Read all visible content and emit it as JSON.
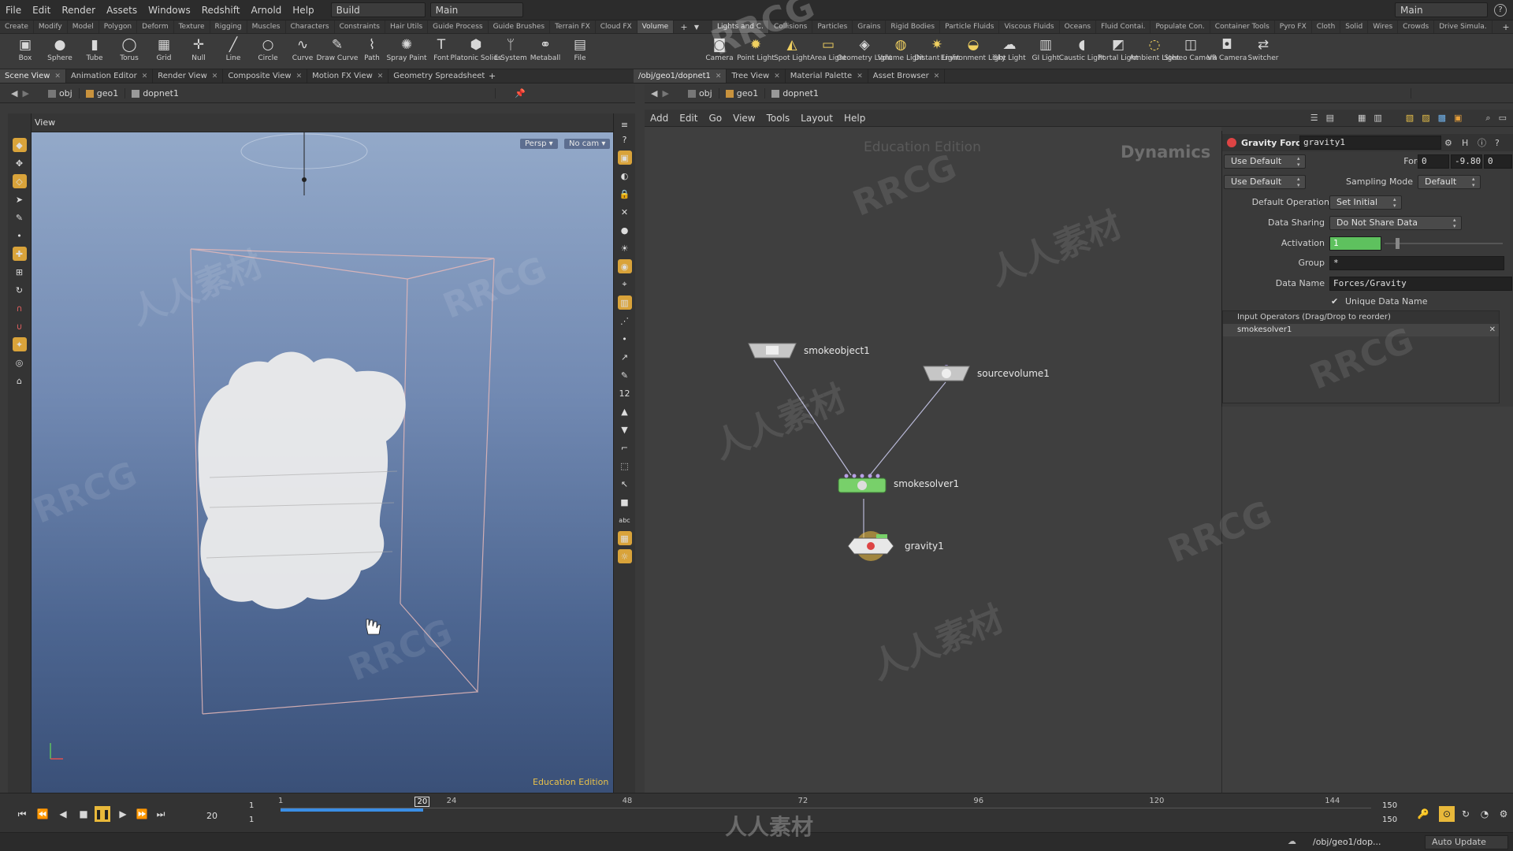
{
  "menubar": {
    "items": [
      "File",
      "Edit",
      "Render",
      "Assets",
      "Windows",
      "Redshift",
      "Arnold",
      "Help"
    ],
    "desktop_label": "Build",
    "main_label": "Main",
    "right_label": "Main"
  },
  "shelf_tabs_left": [
    "Create",
    "Modify",
    "Model",
    "Polygon",
    "Deform",
    "Texture",
    "Rigging",
    "Muscles",
    "Characters",
    "Constraints",
    "Hair Utils",
    "Guide Process",
    "Guide Brushes",
    "Terrain FX",
    "Cloud FX",
    "Volume"
  ],
  "shelf_tabs_right": [
    "Lights and C.",
    "Collisions",
    "Particles",
    "Grains",
    "Rigid Bodies",
    "Particle Fluids",
    "Viscous Fluids",
    "Oceans",
    "Fluid Contai.",
    "Populate Con.",
    "Container Tools",
    "Pyro FX",
    "Cloth",
    "Solid",
    "Wires",
    "Crowds",
    "Drive Simula."
  ],
  "tools_left": [
    {
      "label": "Box",
      "icon": "box-icon"
    },
    {
      "label": "Sphere",
      "icon": "sphere-icon"
    },
    {
      "label": "Tube",
      "icon": "tube-icon"
    },
    {
      "label": "Torus",
      "icon": "torus-icon"
    },
    {
      "label": "Grid",
      "icon": "grid-icon"
    },
    {
      "label": "Null",
      "icon": "null-icon"
    },
    {
      "label": "Line",
      "icon": "line-icon"
    },
    {
      "label": "Circle",
      "icon": "circle-icon"
    },
    {
      "label": "Curve",
      "icon": "curve-icon"
    },
    {
      "label": "Draw Curve",
      "icon": "draw-curve-icon"
    },
    {
      "label": "Path",
      "icon": "path-icon"
    },
    {
      "label": "Spray Paint",
      "icon": "spray-paint-icon"
    },
    {
      "label": "Font",
      "icon": "font-icon"
    },
    {
      "label": "Platonic Solids",
      "icon": "platonic-icon"
    },
    {
      "label": "L-System",
      "icon": "lsystem-icon"
    },
    {
      "label": "Metaball",
      "icon": "metaball-icon"
    },
    {
      "label": "File",
      "icon": "file-icon"
    }
  ],
  "tools_right": [
    {
      "label": "Camera",
      "icon": "camera-icon"
    },
    {
      "label": "Point Light",
      "icon": "point-light-icon"
    },
    {
      "label": "Spot Light",
      "icon": "spot-light-icon"
    },
    {
      "label": "Area Light",
      "icon": "area-light-icon"
    },
    {
      "label": "Geometry Light",
      "icon": "geometry-light-icon"
    },
    {
      "label": "Volume Light",
      "icon": "volume-light-icon"
    },
    {
      "label": "Distant Light",
      "icon": "distant-light-icon"
    },
    {
      "label": "Environment Light",
      "icon": "environment-light-icon"
    },
    {
      "label": "Sky Light",
      "icon": "sky-light-icon"
    },
    {
      "label": "GI Light",
      "icon": "gi-light-icon"
    },
    {
      "label": "Caustic Light",
      "icon": "caustic-light-icon"
    },
    {
      "label": "Portal Light",
      "icon": "portal-light-icon"
    },
    {
      "label": "Ambient Light",
      "icon": "ambient-light-icon"
    },
    {
      "label": "Stereo Camera",
      "icon": "stereo-camera-icon"
    },
    {
      "label": "VR Camera",
      "icon": "vr-camera-icon"
    },
    {
      "label": "Switcher",
      "icon": "switcher-icon"
    }
  ],
  "left_pane_tabs": [
    "Scene View",
    "Animation Editor",
    "Render View",
    "Composite View",
    "Motion FX View",
    "Geometry Spreadsheet"
  ],
  "right_pane_tabs": [
    "/obj/geo1/dopnet1",
    "Tree View",
    "Material Palette",
    "Asset Browser"
  ],
  "path": {
    "obj": "obj",
    "geo": "geo1",
    "net": "dopnet1"
  },
  "viewport": {
    "title": "View",
    "persp": "Persp",
    "cam": "No cam",
    "edition": "Education Edition"
  },
  "network": {
    "menu": [
      "Add",
      "Edit",
      "Go",
      "View",
      "Tools",
      "Layout",
      "Help"
    ],
    "context": "Dynamics",
    "edition": "Education Edition",
    "nodes": {
      "smokeobject": "smokeobject1",
      "sourcevolume": "sourcevolume1",
      "smokesolver": "smokesolver1",
      "gravity": "gravity1"
    }
  },
  "params": {
    "type": "Gravity Force",
    "name": "gravity1",
    "use_default_1": "Use Default",
    "use_default_2": "Use Default",
    "force_label": "Force",
    "force": [
      "0",
      "-9.80",
      "0"
    ],
    "sampling_label": "Sampling Mode",
    "sampling": "Default",
    "defop_label": "Default Operation",
    "defop": "Set Initial",
    "sharing_label": "Data Sharing",
    "sharing": "Do Not Share Data",
    "activation_label": "Activation",
    "activation": "1",
    "group_label": "Group",
    "group": "*",
    "dataname_label": "Data Name",
    "dataname": "Forces/Gravity",
    "unique_label": "Unique Data Name",
    "inputs_header": "Input Operators (Drag/Drop to reorder)",
    "input_item": "smokesolver1"
  },
  "timeline": {
    "current": "20",
    "start": "1",
    "start2": "1",
    "end": "150",
    "end2": "150",
    "ticks": [
      "1",
      "24",
      "48",
      "72",
      "96",
      "120",
      "144"
    ],
    "marker": "20",
    "progress": 0.131
  },
  "status": {
    "path": "/obj/geo1/dop...",
    "auto": "Auto Update"
  },
  "watermark": {
    "a": "RRCG",
    "b": "人人素材"
  },
  "colors": {
    "accent_green": "#5ec15e",
    "accent_yellow": "#e8b83a",
    "viewport_top": "#93a9c9",
    "viewport_bottom": "#3a5078"
  }
}
